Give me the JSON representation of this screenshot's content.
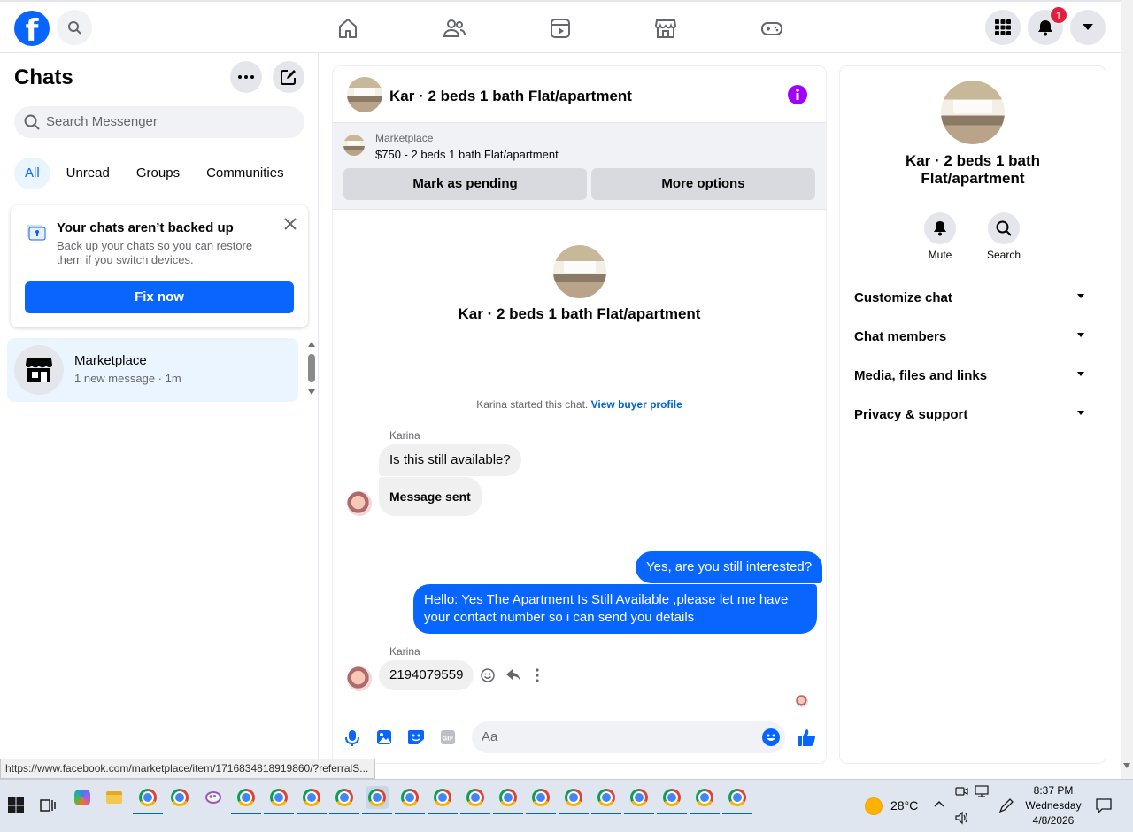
{
  "header": {
    "notification_count": "1"
  },
  "sidebar": {
    "title": "Chats",
    "search_placeholder": "Search Messenger",
    "tabs": [
      "All",
      "Unread",
      "Groups",
      "Communities"
    ],
    "backup": {
      "title": "Your chats aren’t backed up",
      "body": "Back up your chats so you can restore them if you switch devices.",
      "button": "Fix now"
    },
    "chats": [
      {
        "name": "Marketplace",
        "preview": "1 new message · 1m"
      }
    ]
  },
  "conversation": {
    "title": "Kar · 2 beds 1 bath Flat/apartment",
    "marketplace": {
      "label": "Marketplace",
      "listing": "$750 - 2 beds 1 bath Flat/apartment",
      "mark_pending": "Mark as pending",
      "more_options": "More options"
    },
    "intro_title": "Kar · 2 beds 1 bath Flat/apartment",
    "started_text": "Karina started this chat.",
    "buyer_profile_link": "View buyer profile",
    "sender_name": "Karina",
    "messages_in_1": [
      "Is this still available?",
      "Message sent"
    ],
    "messages_out": [
      "Yes, are you still interested?",
      "Hello: Yes The Apartment Is Still Available ,please let me have your contact number so i can send you details"
    ],
    "message_in_2": "2194079559",
    "composer_placeholder": "Aa"
  },
  "details": {
    "title": "Kar · 2 beds 1 bath Flat/apartment",
    "actions": [
      "Mute",
      "Search"
    ],
    "sections": [
      "Customize chat",
      "Chat members",
      "Media, files and links",
      "Privacy & support"
    ]
  },
  "status_url": "https://www.facebook.com/marketplace/item/1716834818919860/?referralS...",
  "taskbar": {
    "weather": "28°C",
    "time": "8:37 PM",
    "day": "Wednesday",
    "date": "4/8/2026"
  },
  "colors": {
    "brand": "#0866ff",
    "badge": "#e41e3f",
    "info": "#a100ff"
  }
}
